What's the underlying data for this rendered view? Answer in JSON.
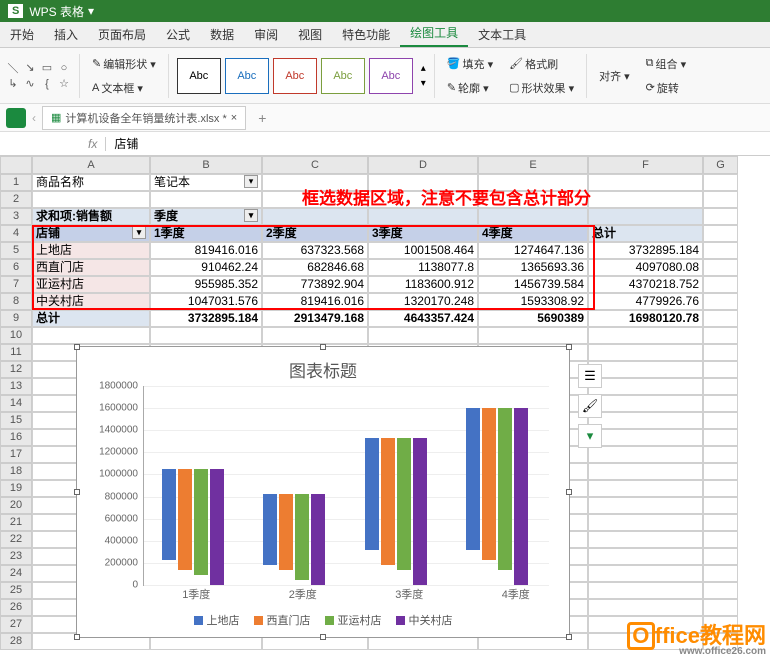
{
  "app": {
    "logo": "S",
    "name": "WPS 表格",
    "dropdown": "▾"
  },
  "menu": [
    "开始",
    "插入",
    "页面布局",
    "公式",
    "数据",
    "审阅",
    "视图",
    "特色功能",
    "绘图工具",
    "文本工具"
  ],
  "menuActive": 8,
  "ribbon": {
    "editShape": "编辑形状 ▾",
    "textBox": "文本框 ▾",
    "styleLabel": "Abc",
    "fill": "填充 ▾",
    "outline": "轮廓 ▾",
    "formatPainter": "格式刷",
    "shapeEffect": "形状效果 ▾",
    "align": "对齐 ▾",
    "combine": "组合 ▾",
    "rotate": "旋转"
  },
  "docTab": {
    "name": "计算机设备全年销量统计表.xlsx *",
    "close": "×",
    "plus": "+"
  },
  "formulaBar": {
    "nameBox": "",
    "fx": "fx",
    "value": "店铺"
  },
  "cols": [
    "A",
    "B",
    "C",
    "D",
    "E",
    "F",
    "G"
  ],
  "annotation": "框选数据区域，注意不要包含总计部分",
  "table": {
    "r1": {
      "a": "商品名称",
      "b": "笔记本"
    },
    "r3": {
      "a": "求和项:销售额",
      "b": "季度"
    },
    "r4": {
      "a": "店铺",
      "b": "1季度",
      "c": "2季度",
      "d": "3季度",
      "e": "4季度",
      "f": "总计"
    },
    "r5": {
      "a": "上地店",
      "b": "819416.016",
      "c": "637323.568",
      "d": "1001508.464",
      "e": "1274647.136",
      "f": "3732895.184"
    },
    "r6": {
      "a": "西直门店",
      "b": "910462.24",
      "c": "682846.68",
      "d": "1138077.8",
      "e": "1365693.36",
      "f": "4097080.08"
    },
    "r7": {
      "a": "亚运村店",
      "b": "955985.352",
      "c": "773892.904",
      "d": "1183600.912",
      "e": "1456739.584",
      "f": "4370218.752"
    },
    "r8": {
      "a": "中关村店",
      "b": "1047031.576",
      "c": "819416.016",
      "d": "1320170.248",
      "e": "1593308.92",
      "f": "4779926.76"
    },
    "r9": {
      "a": "总计",
      "b": "3732895.184",
      "c": "2913479.168",
      "d": "4643357.424",
      "e": "5690389",
      "f": "16980120.78"
    }
  },
  "chart_data": {
    "type": "bar",
    "title": "图表标题",
    "categories": [
      "1季度",
      "2季度",
      "3季度",
      "4季度"
    ],
    "series": [
      {
        "name": "上地店",
        "color": "#4472c4",
        "values": [
          819416,
          637324,
          1001508,
          1274647
        ]
      },
      {
        "name": "西直门店",
        "color": "#ed7d31",
        "values": [
          910462,
          682847,
          1138078,
          1365693
        ]
      },
      {
        "name": "亚运村店",
        "color": "#70ad47",
        "values": [
          955985,
          773893,
          1183601,
          1456740
        ]
      },
      {
        "name": "中关村店",
        "color": "#7030a0",
        "values": [
          1047032,
          819416,
          1320170,
          1593309
        ]
      }
    ],
    "ylim": [
      0,
      1800000
    ],
    "yticks": [
      0,
      200000,
      400000,
      600000,
      800000,
      1000000,
      1200000,
      1400000,
      1600000,
      1800000
    ]
  },
  "chartTools": [
    "☰",
    "🖌",
    "▾"
  ],
  "watermark": {
    "o": "O",
    "text": "ffice教程网",
    "sub": "www.office26.com"
  }
}
